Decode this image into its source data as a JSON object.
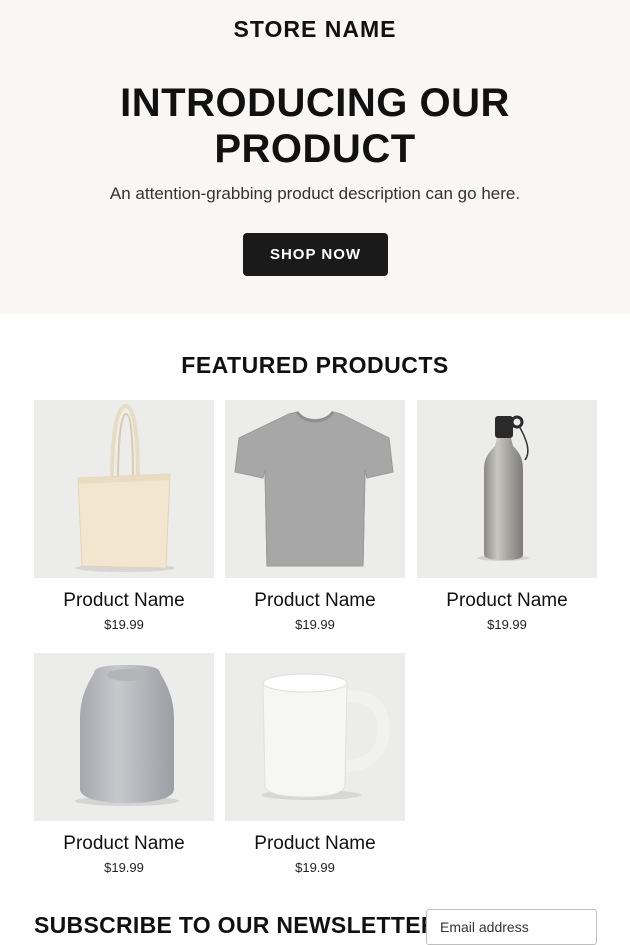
{
  "hero": {
    "store_name": "STORE NAME",
    "title": "INTRODUCING OUR PRODUCT",
    "description": "An attention-grabbing product description can go here.",
    "cta_label": "SHOP NOW"
  },
  "featured": {
    "title": "FEATURED PRODUCTS",
    "products": [
      {
        "name": "Product Name",
        "price": "$19.99",
        "image": "tote-bag"
      },
      {
        "name": "Product Name",
        "price": "$19.99",
        "image": "t-shirt"
      },
      {
        "name": "Product Name",
        "price": "$19.99",
        "image": "water-bottle"
      },
      {
        "name": "Product Name",
        "price": "$19.99",
        "image": "vase"
      },
      {
        "name": "Product Name",
        "price": "$19.99",
        "image": "mug"
      }
    ]
  },
  "newsletter": {
    "title": "SUBSCRIBE TO OUR NEWSLETTER",
    "email_placeholder": "Email address"
  }
}
